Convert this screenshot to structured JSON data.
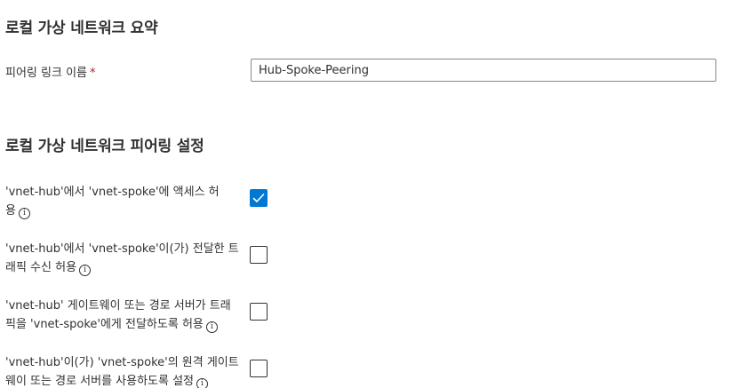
{
  "summary_section": {
    "title": "로컬 가상 네트워크 요약",
    "peering_link_name_label": "피어링 링크 이름",
    "required_marker": "*",
    "peering_link_name_value": "Hub-Spoke-Peering"
  },
  "settings_section": {
    "title": "로컬 가상 네트워크 피어링 설정",
    "options": [
      {
        "line1": "'vnet-hub'에서 'vnet-spoke'에 액세스 허",
        "line2": "용",
        "checked": true
      },
      {
        "line1": "'vnet-hub'에서 'vnet-spoke'이(가) 전달한 트",
        "line2": "래픽 수신 허용",
        "checked": false
      },
      {
        "line1": "'vnet-hub' 게이트웨이 또는 경로 서버가 트래",
        "line2": "픽을 'vnet-spoke'에게 전달하도록 허용",
        "checked": false
      },
      {
        "line1": "'vnet-hub'이(가) 'vnet-spoke'의 원격 게이트",
        "line2": "웨이 또는 경로 서버를 사용하도록 설정",
        "checked": false
      }
    ]
  },
  "icons": {
    "info": "info-icon",
    "info_glyph": "i",
    "checkmark": "checkmark-icon"
  },
  "colors": {
    "accent": "#0078d4",
    "required": "#a4262c",
    "text": "#323130",
    "input_border": "#8a8886"
  }
}
